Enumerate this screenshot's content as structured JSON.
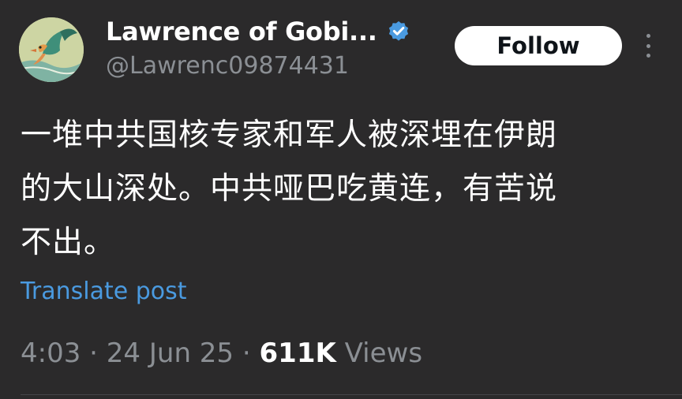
{
  "author": {
    "display_name": "Lawrence of Gobi...",
    "handle": "@Lawrenc09874431",
    "verified": true,
    "avatar_icon": "bird-illustration-avatar"
  },
  "actions": {
    "follow_label": "Follow",
    "more_icon": "vertical-ellipsis-icon"
  },
  "post": {
    "lines": [
      "一堆中共国核专家和军人被深埋在伊朗",
      "的大山深处。中共哑巴吃黄连，有苦说",
      "不出。"
    ],
    "translate_label": "Translate post"
  },
  "meta": {
    "time": "4:03",
    "separator": "·",
    "date": "24 Jun 25",
    "views_count": "611K",
    "views_label": "Views"
  },
  "colors": {
    "background": "#2b2a2b",
    "text": "#ffffff",
    "secondary": "#8b8f94",
    "link": "#4a9ae0",
    "verified_badge": "#4a9ae0"
  }
}
